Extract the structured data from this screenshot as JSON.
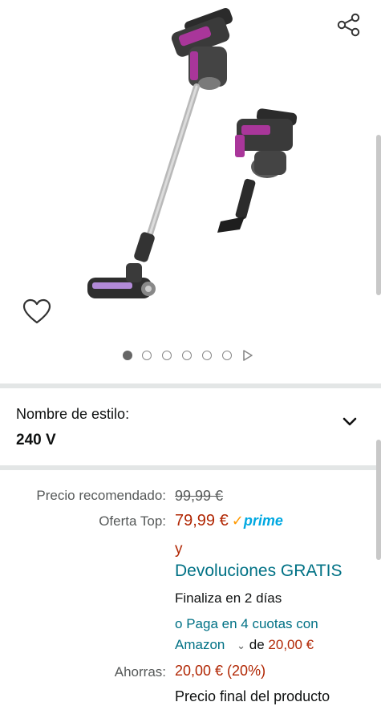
{
  "gallery": {
    "image_alt": "Aspiradora escoba sin cable",
    "dots_total": 6,
    "active_dot": 1
  },
  "style_selector": {
    "label": "Nombre de estilo:",
    "value": "240 V"
  },
  "pricing": {
    "recommended_label": "Precio recomendado:",
    "recommended_price": "99,99 €",
    "offer_label": "Oferta Top:",
    "offer_price": "79,99 €",
    "prime_check": "✓",
    "prime_word": "prime",
    "and_text": "y",
    "free_returns": "Devoluciones GRATIS",
    "ends_text": "Finaliza en 2 días",
    "installments_prefix": "o",
    "installments_link_1": "Paga en 4 cuotas con",
    "installments_link_2": "Amazon",
    "installments_of": "de",
    "installments_amount": "20,00 €",
    "savings_label": "Ahorras:",
    "savings_value": "20,00 € (20%)",
    "final_price_text": "Precio final del producto"
  },
  "colors": {
    "price_red": "#b12704",
    "link_teal": "#007185",
    "prime_blue": "#00a8e1",
    "prime_orange": "#ff9900",
    "divider": "#e3e6e6",
    "accent_magenta": "#a9369a"
  }
}
